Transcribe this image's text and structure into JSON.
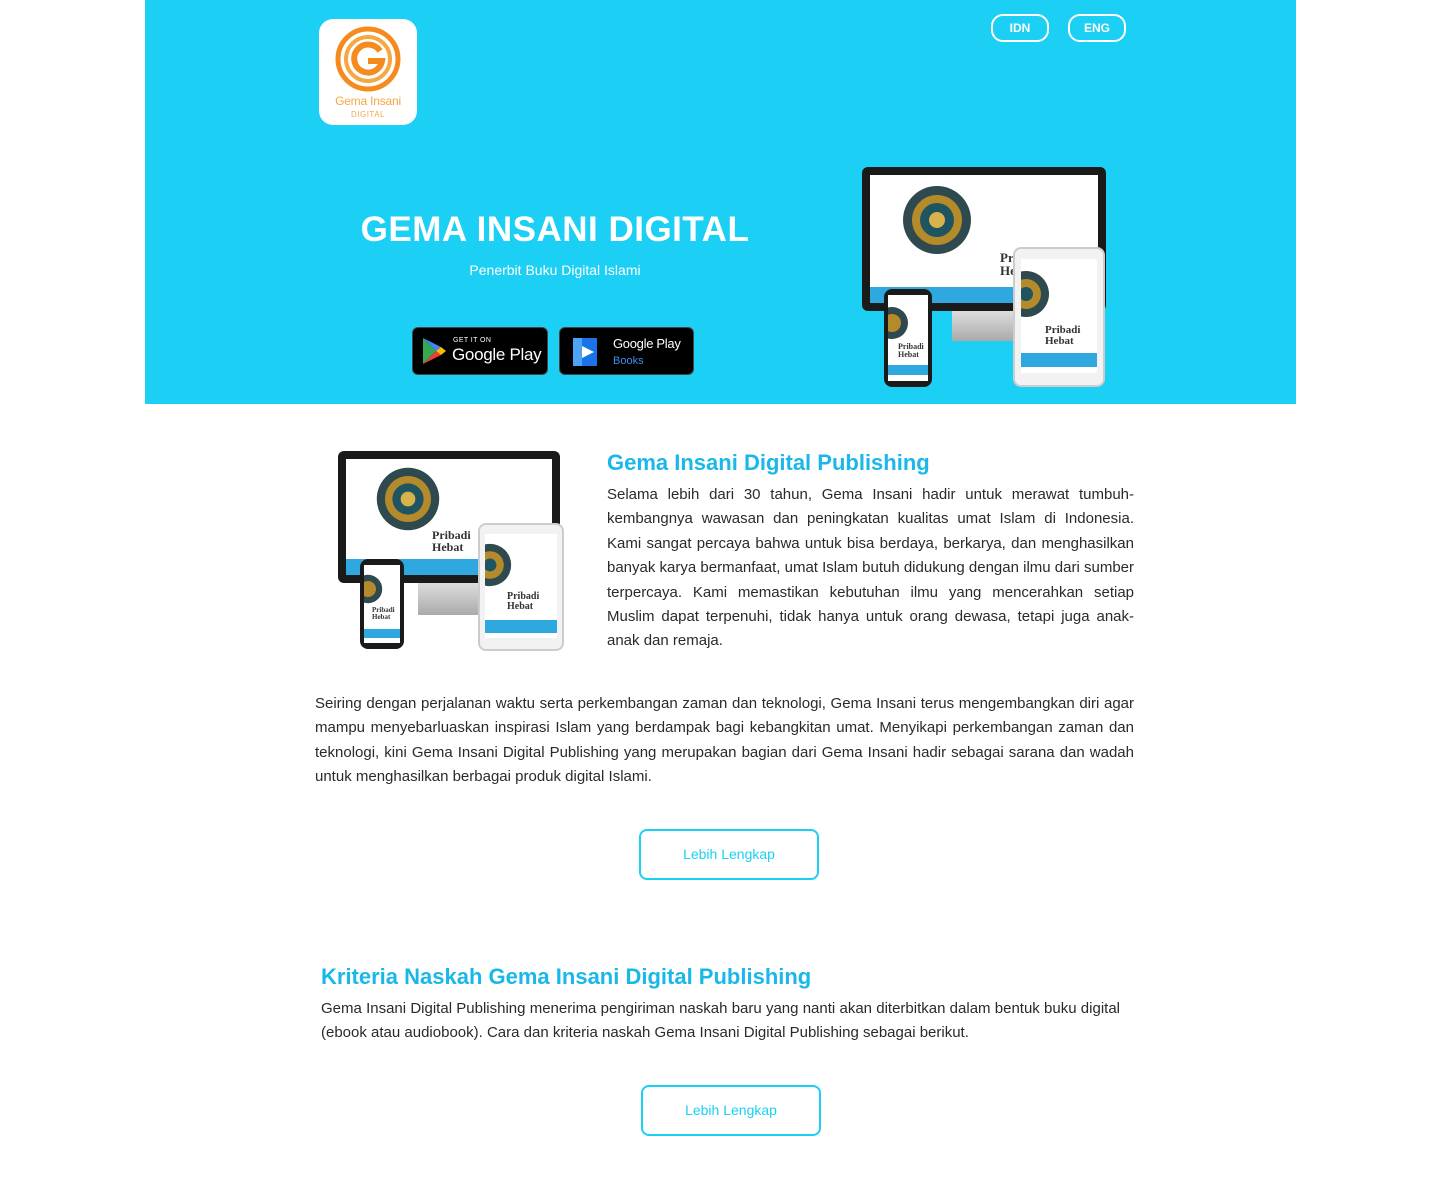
{
  "brand": {
    "logo_name": "Gema Insani",
    "logo_sub": "DIGITAL",
    "accent_color": "#1ccff4",
    "logo_color": "#f5a742"
  },
  "header": {
    "lang_idn": "IDN",
    "lang_eng": "ENG"
  },
  "hero": {
    "title": "GEMA INSANI DIGITAL",
    "subtitle": "Penerbit Buku Digital Islami",
    "badges": {
      "google_play_small": "GET IT ON",
      "google_play_big": "Google Play",
      "google_books_big": "Google Play",
      "google_books_small": "Books"
    },
    "mockup_book_title_line1": "Pribadi",
    "mockup_book_title_line2": "Hebat"
  },
  "intro": {
    "heading": "Gema Insani Digital Publishing",
    "paragraph1": "Selama lebih dari 30 tahun, Gema Insani hadir untuk merawat tumbuh-kembangnya wawasan dan peningkatan kualitas umat Islam di Indonesia. Kami sangat percaya bahwa untuk bisa berdaya, berkarya, dan menghasilkan banyak karya bermanfaat, umat Islam butuh didukung dengan ilmu dari sumber terpercaya. Kami memastikan kebutuhan ilmu yang mencerahkan setiap Muslim dapat terpenuhi, tidak hanya untuk orang dewasa, tetapi juga anak-anak dan remaja.",
    "paragraph2": "Seiring dengan perjalanan waktu serta perkembangan zaman dan teknologi, Gema Insani terus mengembangkan diri agar mampu menyebarluaskan inspirasi Islam yang berdampak bagi kebangkitan umat. Menyikapi perkembangan zaman dan teknologi, kini Gema Insani Digital Publishing yang merupakan bagian dari Gema Insani hadir sebagai sarana dan wadah untuk menghasilkan berbagai produk digital Islami.",
    "more_label": "Lebih Lengkap"
  },
  "criteria": {
    "heading": "Kriteria Naskah Gema Insani Digital Publishing",
    "paragraph": "Gema Insani Digital Publishing menerima pengiriman naskah baru yang nanti akan diterbitkan dalam bentuk buku digital (ebook atau audiobook). Cara dan kriteria naskah Gema Insani Digital Publishing sebagai berikut.",
    "more_label": "Lebih Lengkap"
  }
}
